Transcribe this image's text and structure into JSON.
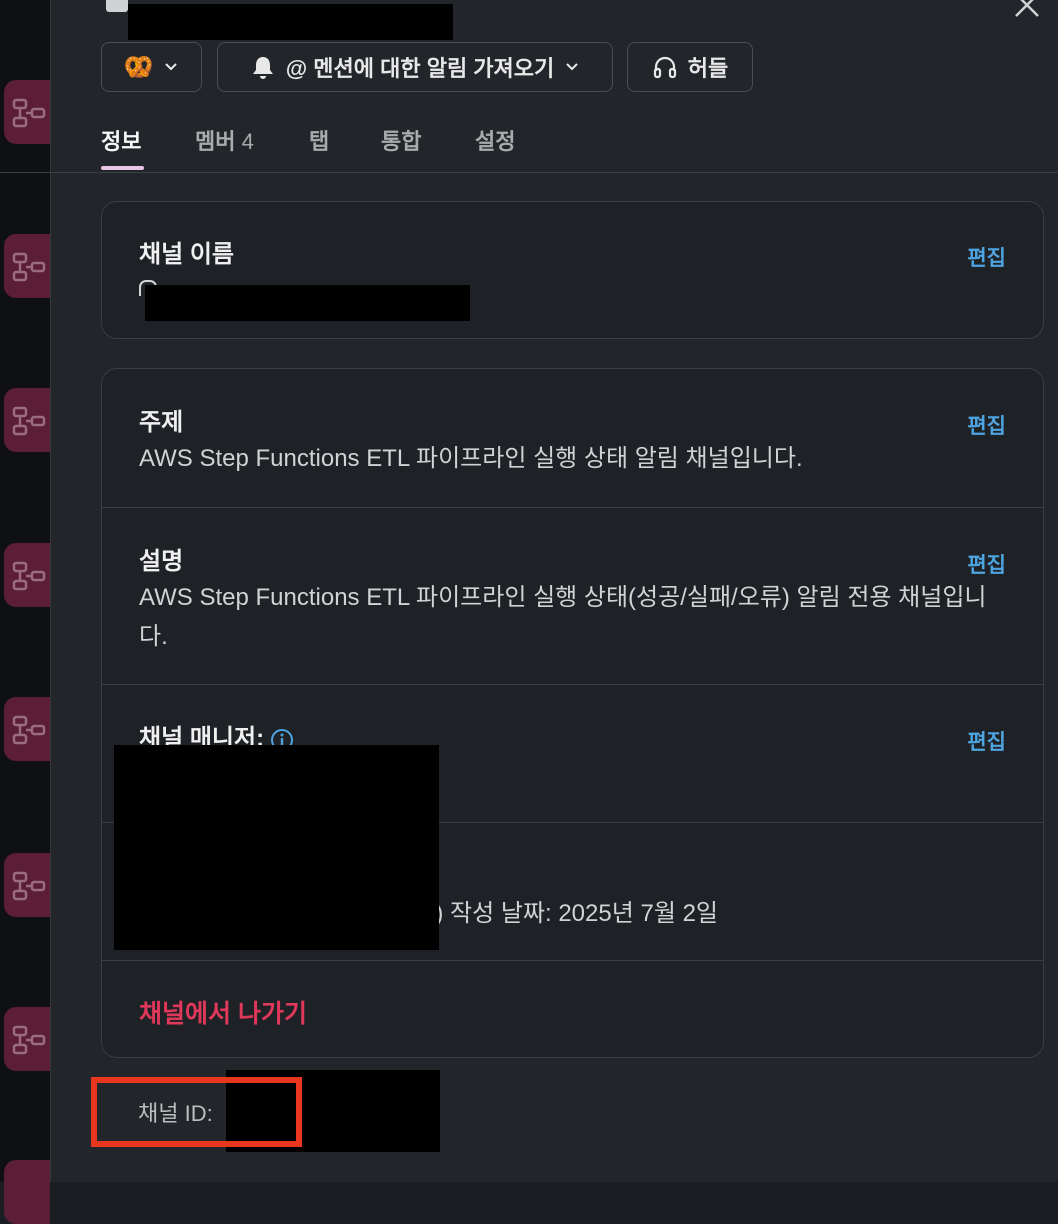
{
  "header": {
    "emoji_button": {
      "emoji": "🥨"
    },
    "notify_button_label": "@ 멘션에 대한 알림 가져오기",
    "huddle_button_label": "허들"
  },
  "tabs": [
    {
      "label": "정보",
      "active": true
    },
    {
      "label": "멤버",
      "count": "4"
    },
    {
      "label": "탭"
    },
    {
      "label": "통합"
    },
    {
      "label": "설정"
    }
  ],
  "channel_name": {
    "title": "채널 이름",
    "edit": "편집"
  },
  "topic": {
    "title": "주제",
    "text": "AWS Step Functions ETL 파이프라인 실행 상태 알림 채널입니다.",
    "edit": "편집"
  },
  "description": {
    "title": "설명",
    "text": "AWS Step Functions ETL 파이프라인 실행 상태(성공/실패/오류) 알림 전용 채널입니다.",
    "edit": "편집"
  },
  "managers": {
    "title": "채널 매니저:",
    "edit": "편집"
  },
  "created": {
    "text": "a) 작성 날짜: 2025년 7월 2일"
  },
  "leave_label": "채널에서 나가기",
  "channel_id_label": "채널 ID:",
  "colors": {
    "accent_link": "#4ea4e0",
    "danger": "#e0385a",
    "highlight": "#e8361f",
    "tab_underline": "#e8c5e6"
  }
}
